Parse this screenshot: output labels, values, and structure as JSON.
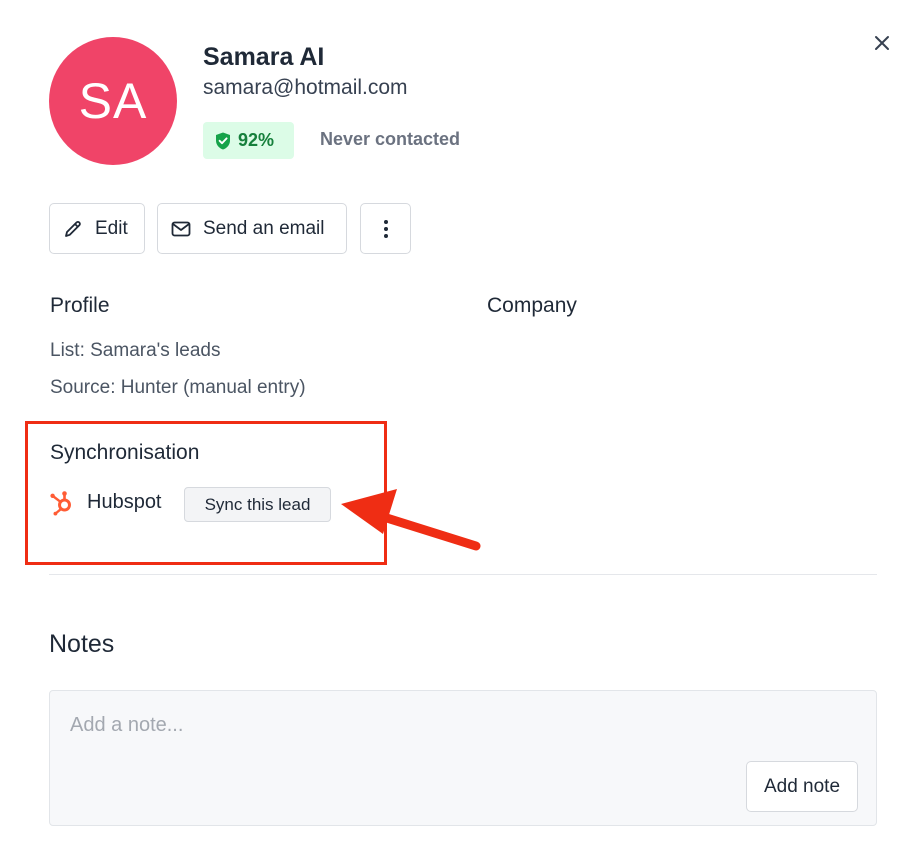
{
  "contact": {
    "initials": "SA",
    "name": "Samara AI",
    "email": "samara@hotmail.com",
    "score": "92%",
    "contact_status": "Never contacted",
    "avatar_color": "#f04468"
  },
  "actions": {
    "edit_label": "Edit",
    "send_email_label": "Send an email"
  },
  "profile": {
    "heading": "Profile",
    "list_line": "List: Samara's leads",
    "source_line": "Source: Hunter (manual entry)"
  },
  "company": {
    "heading": "Company"
  },
  "synchronisation": {
    "heading": "Synchronisation",
    "integration_name": "Hubspot",
    "sync_button_label": "Sync this lead",
    "highlight_color": "#ef2d14"
  },
  "notes": {
    "heading": "Notes",
    "placeholder": "Add a note...",
    "add_button_label": "Add note"
  },
  "icons": {
    "close": "close-icon",
    "shield": "shield-check-icon",
    "pencil": "pencil-icon",
    "envelope": "envelope-icon",
    "more": "more-vertical-icon",
    "hubspot": "hubspot-icon"
  }
}
